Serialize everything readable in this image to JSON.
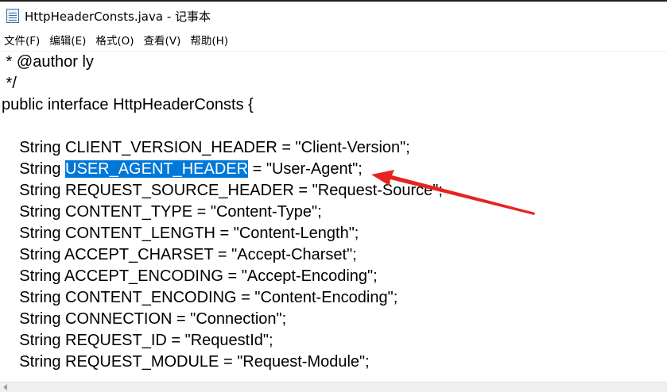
{
  "window": {
    "title": "HttpHeaderConsts.java - 记事本",
    "icon": "notepad-icon"
  },
  "menu": {
    "items": [
      {
        "label": "文件(F)"
      },
      {
        "label": "编辑(E)"
      },
      {
        "label": "格式(O)"
      },
      {
        "label": "查看(V)"
      },
      {
        "label": "帮助(H)"
      }
    ]
  },
  "editor": {
    "lines": [
      " * @author ly",
      " */",
      "public interface HttpHeaderConsts {",
      "",
      "    String CLIENT_VERSION_HEADER = \"Client-Version\";",
      "    String ",
      "    String REQUEST_SOURCE_HEADER = \"Request-Source\";",
      "    String CONTENT_TYPE = \"Content-Type\";",
      "    String CONTENT_LENGTH = \"Content-Length\";",
      "    String ACCEPT_CHARSET = \"Accept-Charset\";",
      "    String ACCEPT_ENCODING = \"Accept-Encoding\";",
      "    String CONTENT_ENCODING = \"Content-Encoding\";",
      "    String CONNECTION = \"Connection\";",
      "    String REQUEST_ID = \"RequestId\";",
      "    String REQUEST_MODULE = \"Request-Module\";"
    ],
    "selected_line": {
      "prefix": "    String ",
      "selection": "USER_AGENT_HEADER",
      "suffix": " = \"User-Agent\";"
    }
  },
  "annotation": {
    "arrow_color": "#e8231f",
    "icon": "red-arrow-annotation"
  },
  "colors": {
    "selection_bg": "#0078d7",
    "selection_fg": "#ffffff"
  }
}
